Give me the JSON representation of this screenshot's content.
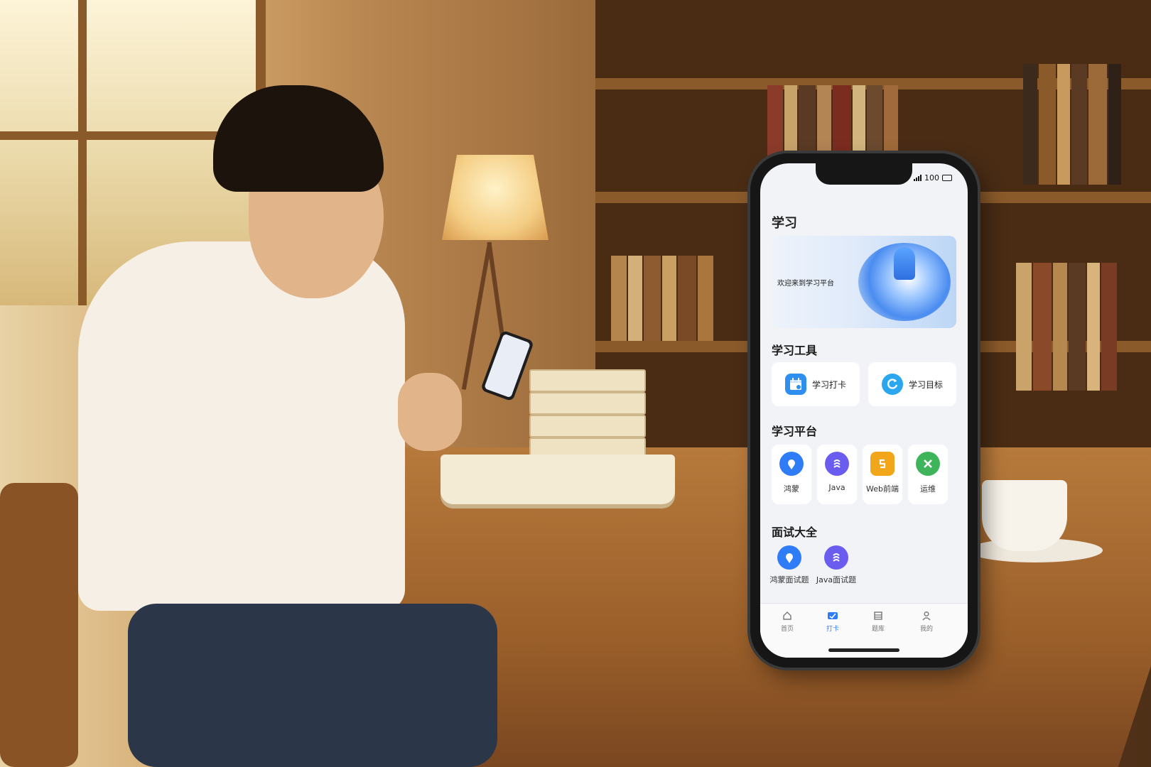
{
  "status_bar": {
    "battery": "100"
  },
  "app": {
    "title": "学习",
    "banner_text": "欢迎来到学习平台"
  },
  "sections": {
    "tools_title": "学习工具",
    "platform_title": "学习平台",
    "interview_title": "面试大全"
  },
  "tools": [
    {
      "label": "学习打卡",
      "icon": "calendar-checkin-icon",
      "color": "#2f8ff0"
    },
    {
      "label": "学习目标",
      "icon": "target-cycle-icon",
      "color": "#2aa7ef"
    }
  ],
  "platforms": [
    {
      "label": "鸿蒙",
      "icon": "harmony-pin-icon",
      "color": "#2f7cf6"
    },
    {
      "label": "Java",
      "icon": "java-icon",
      "color": "#6b5cf0"
    },
    {
      "label": "Web前端",
      "icon": "html5-icon",
      "color": "#f2a61a"
    },
    {
      "label": "运维",
      "icon": "ops-x-icon",
      "color": "#3fb55b"
    }
  ],
  "interviews": [
    {
      "label": "鸿蒙面试题",
      "icon": "harmony-pin-icon",
      "color": "#2f7cf6"
    },
    {
      "label": "Java面试题",
      "icon": "java-icon",
      "color": "#6b5cf0"
    }
  ],
  "tabs": [
    {
      "label": "首页",
      "icon": "home-icon",
      "active": false
    },
    {
      "label": "打卡",
      "icon": "checkin-icon",
      "active": true
    },
    {
      "label": "题库",
      "icon": "list-icon",
      "active": false
    },
    {
      "label": "我的",
      "icon": "profile-icon",
      "active": false
    }
  ]
}
